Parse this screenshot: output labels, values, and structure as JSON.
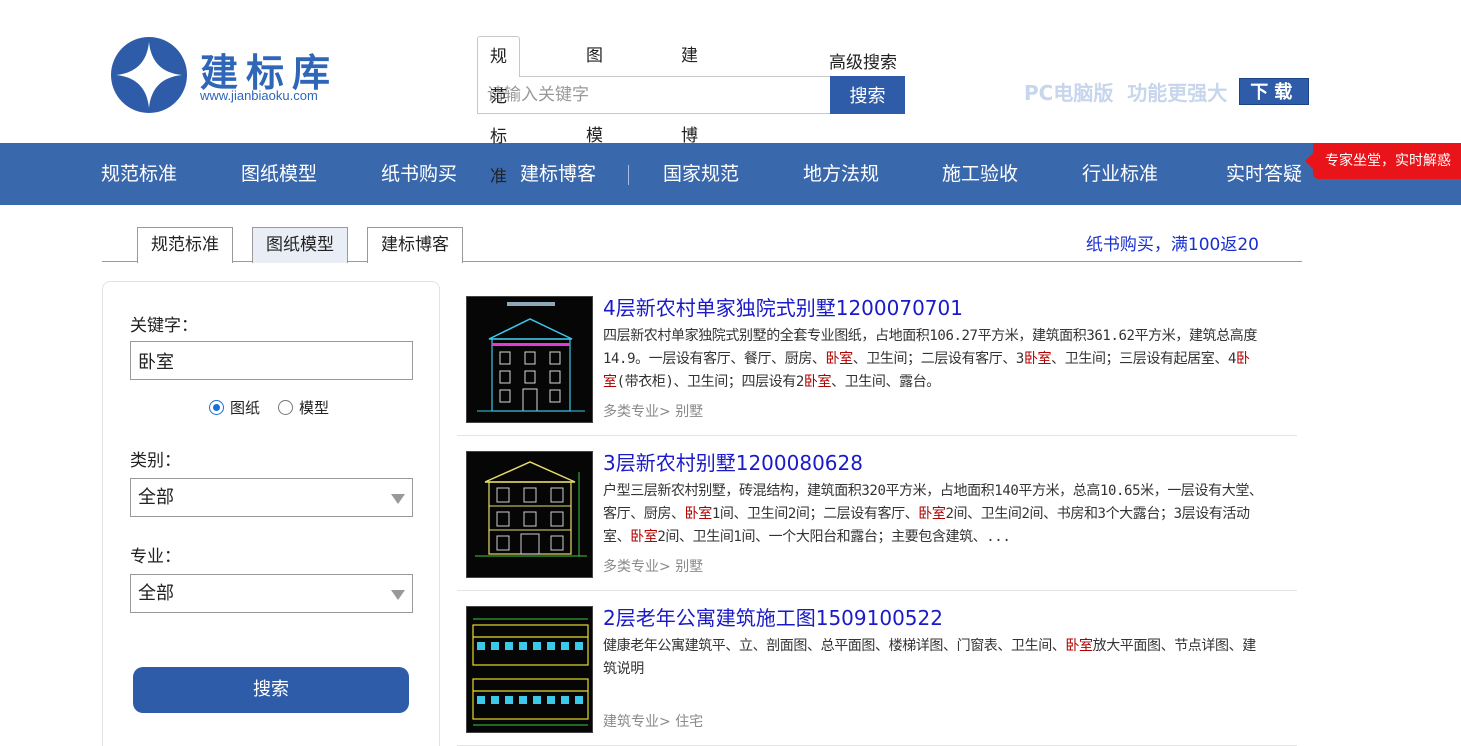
{
  "header": {
    "logo_title": "建标库",
    "logo_url": "www.jianbiaoku.com",
    "search_tabs": [
      "规范标准",
      "图纸模型",
      "建标博客"
    ],
    "advanced_search": "高级搜索",
    "search_placeholder": "请输入关键字",
    "search_button": "搜索",
    "promo_text": "PC电脑版  功能更强大",
    "download_label": "下载"
  },
  "nav": {
    "items": [
      "规范标准",
      "图纸模型",
      "纸书购买",
      "建标博客",
      "国家规范",
      "地方法规",
      "施工验收",
      "行业标准",
      "实时答疑"
    ],
    "badge": "专家坐堂，实时解惑"
  },
  "subtabs": {
    "items": [
      "规范标准",
      "图纸模型",
      "建标博客"
    ],
    "active": 1,
    "promo": "纸书购买，满100返20"
  },
  "sidebar": {
    "keyword_label": "关键字：",
    "keyword_value": "卧室",
    "radio_options": [
      "图纸",
      "模型"
    ],
    "category_label": "类别：",
    "category_value": "全部",
    "specialty_label": "专业：",
    "specialty_value": "全部",
    "search_button": "搜索"
  },
  "results": [
    {
      "title": "4层新农村单家独院式别墅1200070701",
      "desc": [
        {
          "t": "四层新农村单家独院式别墅的全套专业图纸，占地面积106.27平方米，建筑面积361.62平方米，建筑总高度14.9。一层设有客厅、餐厅、厨房、"
        },
        {
          "t": "卧室",
          "hl": true
        },
        {
          "t": "、卫生间；二层设有客厅、3"
        },
        {
          "t": "卧室",
          "hl": true
        },
        {
          "t": "、卫生间；三层设有起居室、4"
        },
        {
          "t": "卧室",
          "hl": true
        },
        {
          "t": "(带衣柜)、卫生间；四层设有2"
        },
        {
          "t": "卧室",
          "hl": true
        },
        {
          "t": "、卫生间、露台。"
        }
      ],
      "tag1": "多类专业>",
      "tag2": "别墅"
    },
    {
      "title": "3层新农村别墅1200080628",
      "desc": [
        {
          "t": "户型三层新农村别墅，砖混结构，建筑面积320平方米，占地面积140平方米，总高10.65米，一层设有大堂、客厅、厨房、"
        },
        {
          "t": "卧室",
          "hl": true
        },
        {
          "t": "1间、卫生间2间；二层设有客厅、"
        },
        {
          "t": "卧室",
          "hl": true
        },
        {
          "t": "2间、卫生间2间、书房和3个大露台；3层设有活动室、"
        },
        {
          "t": "卧室",
          "hl": true
        },
        {
          "t": "2间、卫生间1间、一个大阳台和露台；主要包含建筑、..."
        }
      ],
      "tag1": "多类专业>",
      "tag2": "别墅"
    },
    {
      "title": "2层老年公寓建筑施工图1509100522",
      "desc": [
        {
          "t": "健康老年公寓建筑平、立、剖面图、总平面图、楼梯详图、门窗表、卫生间、"
        },
        {
          "t": "卧室",
          "hl": true
        },
        {
          "t": "放大平面图、节点详图、建筑说明"
        }
      ],
      "tag1": "建筑专业>",
      "tag2": "住宅"
    }
  ],
  "colors": {
    "brand_blue": "#2f5ca8",
    "nav_blue": "#3a68ad",
    "link_blue": "#1a1ac8",
    "highlight_red": "#b00000",
    "badge_red": "#e8141a"
  }
}
